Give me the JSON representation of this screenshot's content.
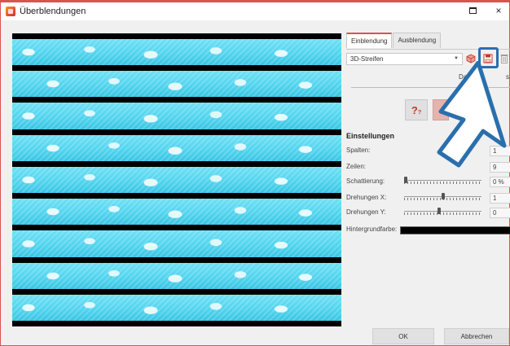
{
  "window": {
    "title": "Überblendungen"
  },
  "tabs": [
    "Einblendung",
    "Ausblendung"
  ],
  "transition": {
    "selected": "3D-Streifen"
  },
  "dauer": {
    "label": "Dau",
    "unit": "s"
  },
  "settings": {
    "title": "Einstellungen",
    "spalten": {
      "label": "Spalten:",
      "value": "1"
    },
    "zeilen": {
      "label": "Zeilen:",
      "value": "9"
    },
    "schattierung": {
      "label": "Schattierung:",
      "value": "0 %",
      "level": 0.0
    },
    "drehungen_x": {
      "label": "Drehungen X:",
      "value": "1",
      "level": 0.5
    },
    "drehungen_y": {
      "label": "Drehungen Y:",
      "value": "0",
      "level": 0.45
    },
    "hintergrundfarbe": {
      "label": "Hintergrundfarbe:",
      "color": "#000000"
    }
  },
  "help_glyph": "?",
  "buttons": {
    "ok": "OK",
    "cancel": "Abbrechen"
  },
  "icons": [
    "app-icon",
    "maximize-icon",
    "close-icon",
    "dropdown-caret-icon",
    "3d-cube-icon",
    "save-icon",
    "delete-icon",
    "pointer-arrow-icon"
  ],
  "colors": {
    "accent": "#d9534f",
    "preview_cyan": "#4fd3ee",
    "highlight": "#2a6fad"
  }
}
